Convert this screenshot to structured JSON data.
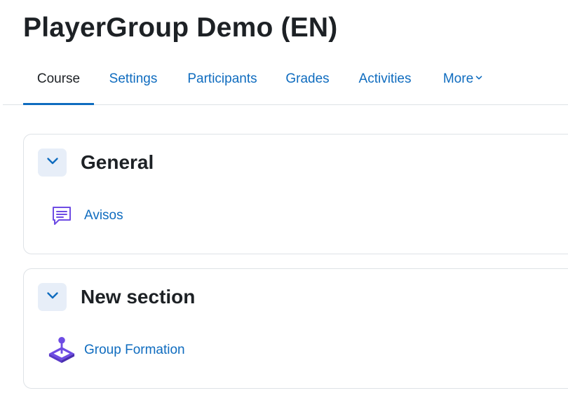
{
  "course": {
    "title": "PlayerGroup Demo (EN)"
  },
  "nav": {
    "tabs": [
      {
        "label": "Course",
        "active": true
      },
      {
        "label": "Settings",
        "active": false
      },
      {
        "label": "Participants",
        "active": false
      },
      {
        "label": "Grades",
        "active": false
      },
      {
        "label": "Activities",
        "active": false
      },
      {
        "label": "More",
        "active": false
      }
    ]
  },
  "sections": [
    {
      "title": "General",
      "activities": [
        {
          "name": "Avisos",
          "icon": "forum-icon"
        }
      ]
    },
    {
      "title": "New section",
      "activities": [
        {
          "name": "Group Formation",
          "icon": "joystick-icon"
        }
      ]
    }
  ],
  "colors": {
    "link": "#0f6cbf",
    "text": "#1d2125",
    "border": "#dee2e6",
    "collapse_bg": "#e7eef8",
    "activity_icon": "#6e4ce4"
  }
}
